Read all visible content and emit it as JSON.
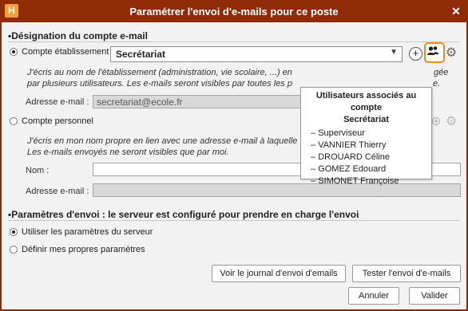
{
  "window": {
    "title": "Paramétrer l'envoi d'e-mails pour ce poste",
    "logo_letter": "H"
  },
  "section_account": {
    "title": "Désignation du compte e-mail",
    "school": {
      "radio_label": "Compte établissement",
      "selected_account": "Secrétariat",
      "desc_line1": "J'écris au nom de l'établissement (administration, vie scolaire, ...) en",
      "desc_line1_tail": "gée",
      "desc_line2": "par plusieurs utilisateurs. Les e-mails seront visibles par toutes les p",
      "desc_line2_tail": "e.",
      "email_label": "Adresse e-mail :",
      "email_value": "secretariat@ecole.fr"
    },
    "personal": {
      "radio_label": "Compte personnel",
      "desc_line1": "J'écris en mon nom propre en lien avec une adresse e-mail à laquelle",
      "desc_line2": "Les e-mails envoyés ne seront visibles que par moi.",
      "name_label": "Nom :",
      "name_value": "",
      "email_label": "Adresse e-mail :",
      "email_value": ""
    }
  },
  "popup": {
    "title_line1": "Utilisateurs associés au compte",
    "title_line2": "Secrétariat",
    "users": [
      "Superviseur",
      "VANNIER Thierry",
      "DROUARD Céline",
      "GOMEZ Edouard",
      "SIMONET Françoise"
    ]
  },
  "section_send": {
    "title": "Paramètres d'envoi : le serveur est configuré pour prendre en charge l'envoi",
    "option_server": "Utiliser les paramètres du serveur",
    "option_custom": "Définir mes propres paramètres"
  },
  "buttons": {
    "journal": "Voir le journal d'envoi d'emails",
    "test": "Tester l'envoi d'e-mails",
    "cancel": "Annuler",
    "validate": "Valider"
  },
  "colors": {
    "titlebar": "#8f2b06",
    "highlight": "#f58a1f"
  }
}
